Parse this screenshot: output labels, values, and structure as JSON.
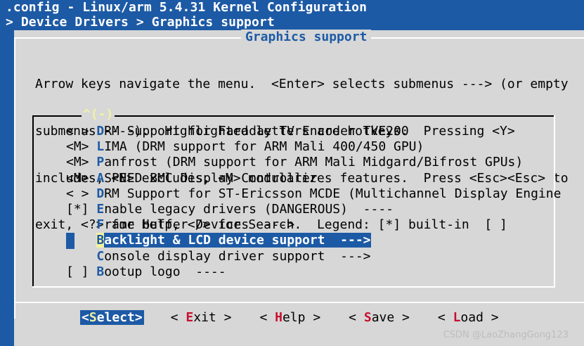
{
  "header": {
    "title": ".config - Linux/arm 5.4.31 Kernel Configuration",
    "breadcrumb": "> Device Drivers > Graphics support"
  },
  "dialog": {
    "title": "Graphics support",
    "help_lines": [
      "Arrow keys navigate the menu.  <Enter> selects submenus ---> (or empty",
      "submenus ----).  Highlighted letters are hotkeys.  Pressing <Y>",
      "includes, <N> excludes, <M> modularizes features.  Press <Esc><Esc> to",
      "exit, <?> for Help, </> for Search.  Legend: [*] built-in  [ ]"
    ],
    "scroll_indicator": "^(-)"
  },
  "menu": {
    "items": [
      {
        "prompt": "< > ",
        "hotkey": "D",
        "rest": "RM Support for Faraday TV Encoder TVE200"
      },
      {
        "prompt": "<M> ",
        "hotkey": "L",
        "rest": "IMA (DRM support for ARM Mali 400/450 GPU)"
      },
      {
        "prompt": "<M> ",
        "hotkey": "P",
        "rest": "anfrost (DRM support for ARM Mali Midgard/Bifrost GPUs)"
      },
      {
        "prompt": "<M> ",
        "hotkey": "A",
        "rest": "SPEED BMC Display Controller"
      },
      {
        "prompt": "< > ",
        "hotkey": "D",
        "rest": "RM Support for ST-Ericsson MCDE (Multichannel Display Engine"
      },
      {
        "prompt": "[*] ",
        "hotkey": "E",
        "rest": "nable legacy drivers (DANGEROUS)  ----"
      },
      {
        "prompt": "    ",
        "hotkey": "F",
        "rest": "rame buffer Devices  --->"
      },
      {
        "prompt": "    ",
        "hotkey": "B",
        "rest": "acklight & LCD device support  --->"
      },
      {
        "prompt": "    ",
        "hotkey": "C",
        "rest": "onsole display driver support  --->"
      },
      {
        "prompt": "[ ] ",
        "hotkey": "B",
        "rest": "ootup logo  ----"
      }
    ],
    "selected_index": 7
  },
  "buttons": [
    {
      "pre": "<",
      "hotkey": "S",
      "post": "elect>",
      "active": true
    },
    {
      "pre": "< ",
      "hotkey": "E",
      "post": "xit >",
      "active": false
    },
    {
      "pre": "< ",
      "hotkey": "H",
      "post": "elp >",
      "active": false
    },
    {
      "pre": "< ",
      "hotkey": "S",
      "post": "ave >",
      "active": false
    },
    {
      "pre": "< ",
      "hotkey": "L",
      "post": "oad >",
      "active": false
    }
  ],
  "watermark": "CSDN @LaoZhangGong123",
  "colors": {
    "background": "#1d5aa5",
    "dialog": "#d7d7d7",
    "hotkey": "#1d5aa5",
    "button_hotkey": "#c8102e",
    "highlight_yellow": "#f2f2a0"
  }
}
